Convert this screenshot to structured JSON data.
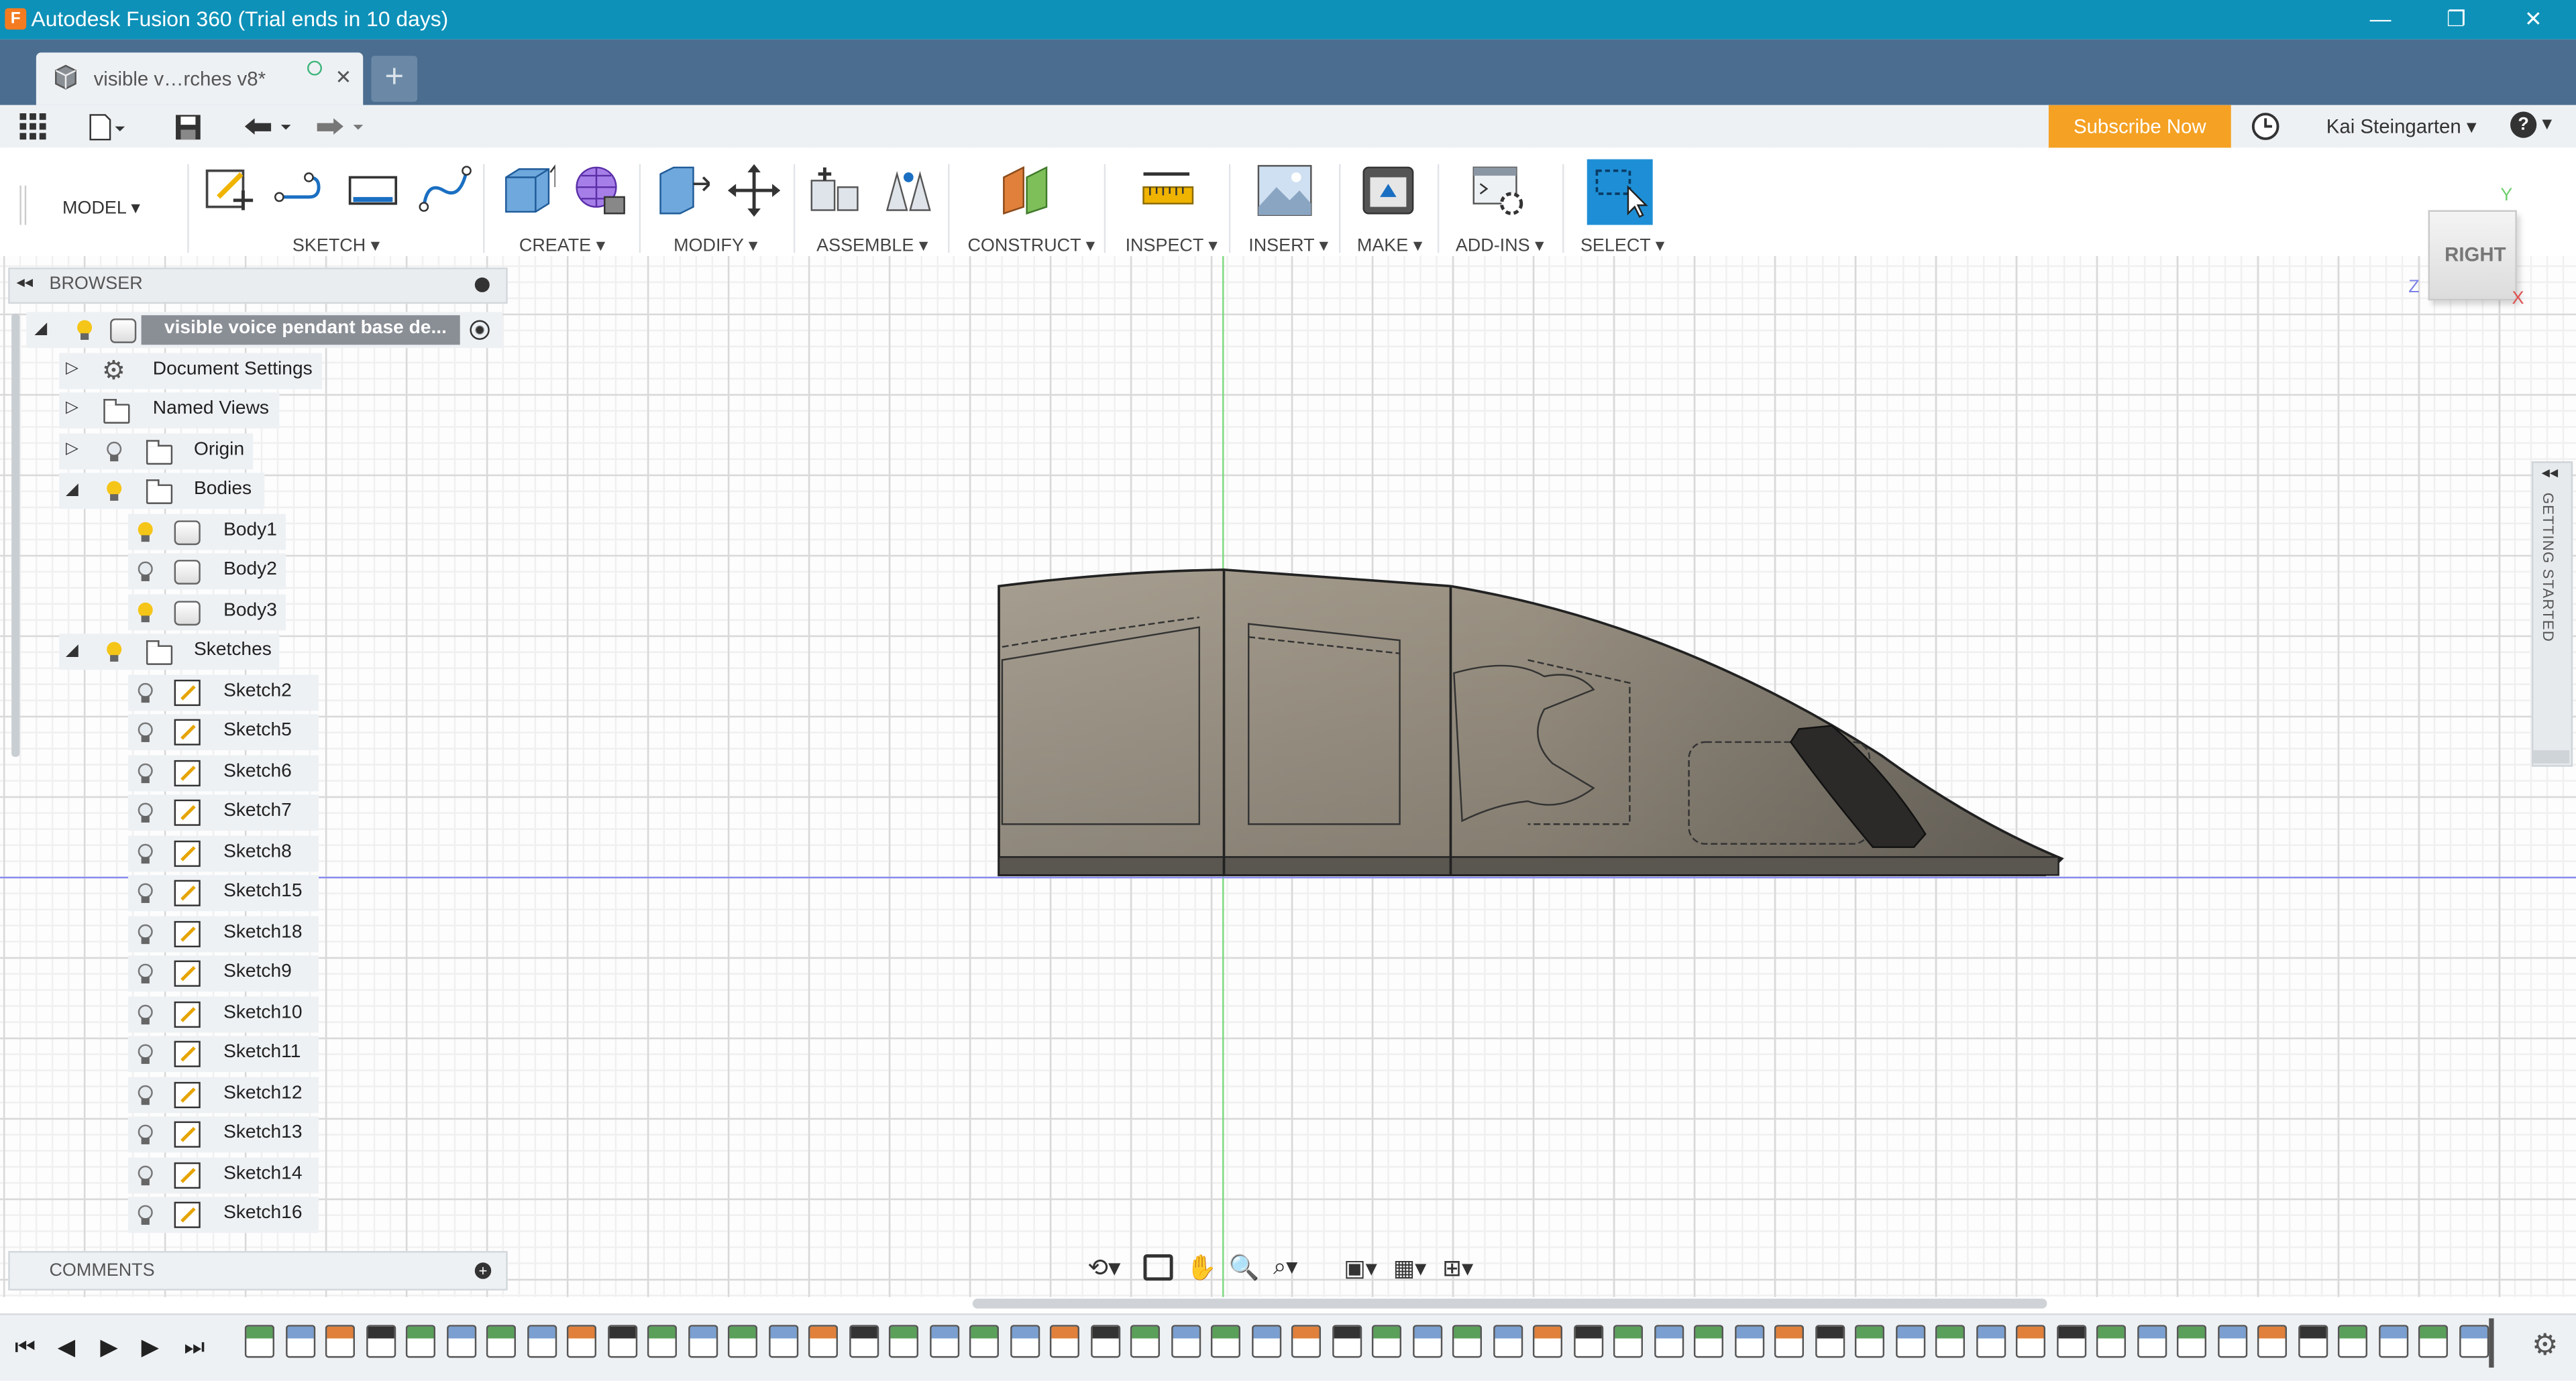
{
  "window": {
    "title": "Autodesk Fusion 360 (Trial ends in 10 days)",
    "controls": {
      "minimize": "—",
      "restore": "❐",
      "close": "✕"
    }
  },
  "tab": {
    "label": "visible v…rches v8*",
    "close": "✕",
    "new_tab": "+"
  },
  "quick_access": {
    "subscribe_label": "Subscribe Now",
    "user_name": "Kai Steingarten ▾",
    "help": "? ▾"
  },
  "toolbar": {
    "workspace": "MODEL ▾",
    "groups": [
      {
        "label": "SKETCH ▾"
      },
      {
        "label": "CREATE ▾"
      },
      {
        "label": "MODIFY ▾"
      },
      {
        "label": "ASSEMBLE ▾"
      },
      {
        "label": "CONSTRUCT ▾"
      },
      {
        "label": "INSPECT ▾"
      },
      {
        "label": "INSERT ▾"
      },
      {
        "label": "MAKE ▾"
      },
      {
        "label": "ADD-INS ▾"
      },
      {
        "label": "SELECT ▾"
      }
    ]
  },
  "browser": {
    "header": "BROWSER",
    "root": "visible voice pendant base de...",
    "items": [
      {
        "label": "Document Settings"
      },
      {
        "label": "Named Views"
      },
      {
        "label": "Origin"
      },
      {
        "label": "Bodies"
      },
      {
        "label": "Body1"
      },
      {
        "label": "Body2"
      },
      {
        "label": "Body3"
      },
      {
        "label": "Sketches"
      },
      {
        "label": "Sketch2"
      },
      {
        "label": "Sketch5"
      },
      {
        "label": "Sketch6"
      },
      {
        "label": "Sketch7"
      },
      {
        "label": "Sketch8"
      },
      {
        "label": "Sketch15"
      },
      {
        "label": "Sketch18"
      },
      {
        "label": "Sketch9"
      },
      {
        "label": "Sketch10"
      },
      {
        "label": "Sketch11"
      },
      {
        "label": "Sketch12"
      },
      {
        "label": "Sketch13"
      },
      {
        "label": "Sketch14"
      },
      {
        "label": "Sketch16"
      }
    ]
  },
  "comments": {
    "label": "COMMENTS"
  },
  "viewcube": {
    "face": "RIGHT",
    "axis_y": "Y",
    "axis_z": "Z",
    "axis_x": "X"
  },
  "side_panel": {
    "label": "GETTING STARTED"
  },
  "colors": {
    "title_bar": "#0e91b8",
    "tab_bar": "#4b6d8f",
    "subscribe": "#f5a123",
    "select_active": "#1e8fd6"
  }
}
